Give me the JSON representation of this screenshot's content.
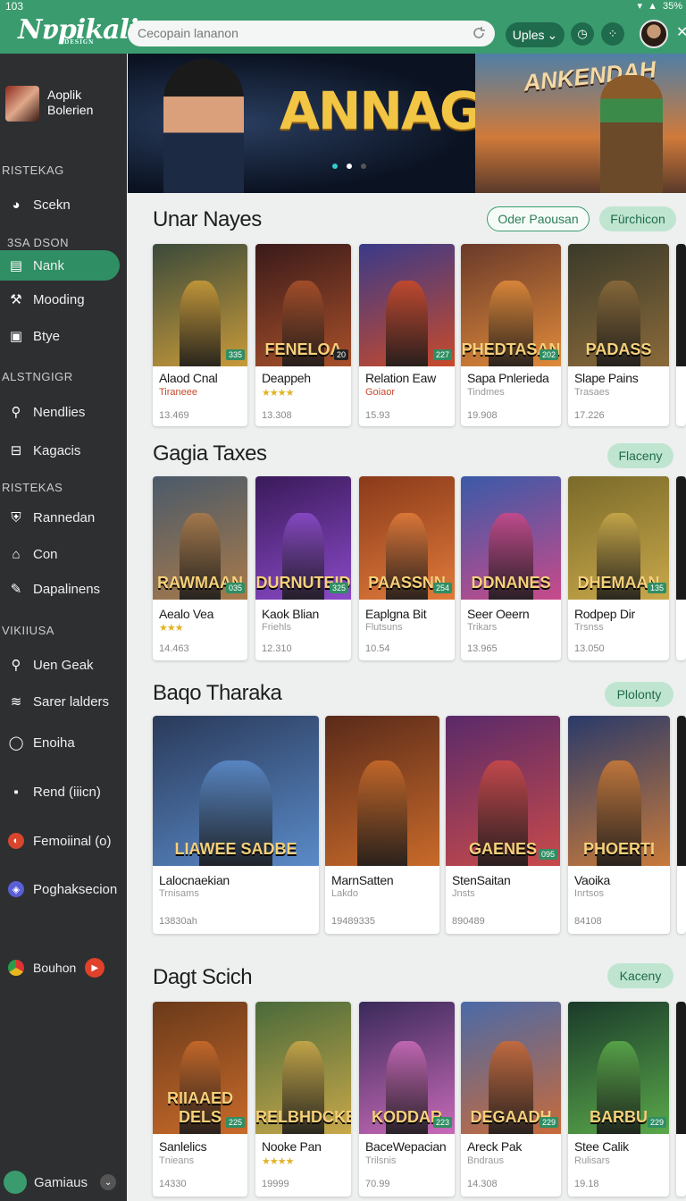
{
  "status": {
    "time": "103",
    "battery": "35%"
  },
  "header": {
    "logo": "Nɐpikali",
    "logo_sub": "DESIGN",
    "search_placeholder": "Cecopain lananon",
    "update_label": "Uples",
    "icons": [
      "clock-icon",
      "grid-icon"
    ]
  },
  "sidebar": {
    "profile": {
      "line1": "Aoplik",
      "line2": "Bolerien"
    },
    "sections": [
      {
        "label": "RISTEKAG",
        "items": [
          {
            "label": "Scekn",
            "icon": "paint-icon"
          }
        ]
      },
      {
        "label": "3SA DSON",
        "items": [
          {
            "label": "Nank",
            "icon": "list-icon",
            "active": true
          },
          {
            "label": "Mooding",
            "icon": "tools-icon"
          },
          {
            "label": "Btye",
            "icon": "square-icon"
          }
        ]
      },
      {
        "label": "ALSTNGIGR",
        "items": [
          {
            "label": "Nendlies",
            "icon": "pin-icon"
          },
          {
            "label": "Kagacis",
            "icon": "window-icon"
          }
        ]
      },
      {
        "label": "RISTEKAS",
        "items": [
          {
            "label": "Rannedan",
            "icon": "shield-icon"
          },
          {
            "label": "Con",
            "icon": "home-icon"
          },
          {
            "label": "Dapalinens",
            "icon": "pen-icon"
          }
        ]
      },
      {
        "label": "VIKIIUSA",
        "items": [
          {
            "label": "Uen Geak",
            "icon": "pin-icon"
          },
          {
            "label": "Sarer lalders",
            "icon": "layers-icon"
          },
          {
            "label": "Enoiha",
            "icon": "chat-icon"
          },
          {
            "label": "Rend (iiicn)",
            "icon": "video-icon"
          },
          {
            "label": "Femoiinal (o)",
            "icon": "circle-icon"
          },
          {
            "label": "Poghaksecion",
            "icon": "compass-icon"
          },
          {
            "label": "Bouhon",
            "icon": "play-icon"
          }
        ]
      }
    ],
    "footer_user": "Gamiaus"
  },
  "hero": {
    "banner1_title": "ANNAGA",
    "banner2_title": "ANKENDAH"
  },
  "sections": [
    {
      "title": "Unar Nayes",
      "buttons": [
        "Oder Paousan",
        "Fürchicon"
      ],
      "cards": [
        {
          "name": "Alaod Cnal",
          "sub": "Tiraneee",
          "sub_style": "rd",
          "count": "13.469",
          "badge": "335",
          "word": ""
        },
        {
          "name": "Deappeh",
          "sub": "★★★★",
          "sub_style": "st",
          "count": "13.308",
          "badge": "20",
          "word": "FENELOA"
        },
        {
          "name": "Relation Eaw",
          "sub": "Goiaor",
          "sub_style": "rd",
          "count": "15.93",
          "badge": "227",
          "word": ""
        },
        {
          "name": "Sapa Pnlerieda",
          "sub": "Tindmes",
          "sub_style": "",
          "count": "19.908",
          "badge": "202",
          "word": "PHEDTASAN"
        },
        {
          "name": "Slape Pains",
          "sub": "Trasaes",
          "sub_style": "",
          "count": "17.226",
          "badge": "",
          "word": "PADASS"
        }
      ]
    },
    {
      "title": "Gagia Taxes",
      "buttons": [
        "Flaceny"
      ],
      "cards": [
        {
          "name": "Aealo Vea",
          "sub": "★★★",
          "sub_style": "st",
          "count": "14.463",
          "badge": "035",
          "word": "RAWMAAN"
        },
        {
          "name": "Kaok Blian",
          "sub": "Friehls",
          "sub_style": "",
          "count": "12.310",
          "badge": "325",
          "word": "DURNUTEID"
        },
        {
          "name": "Eaplgna Bit",
          "sub": "Flutsuns",
          "sub_style": "",
          "count": "10.54",
          "badge": "254",
          "word": "PAASSNN"
        },
        {
          "name": "Seer Oeern",
          "sub": "Trikars",
          "sub_style": "",
          "count": "13.965",
          "badge": "",
          "word": "DDNANES"
        },
        {
          "name": "Rodpep Dir",
          "sub": "Trsnss",
          "sub_style": "",
          "count": "13.050",
          "badge": "135",
          "word": "DHEMAAN"
        }
      ]
    },
    {
      "title": "Baqo Tharaka",
      "buttons": [
        "Plolonty"
      ],
      "cards": [
        {
          "name": "Lalocnaekian",
          "sub": "Trnisams",
          "sub_style": "",
          "count": "13830ah",
          "badge": "",
          "word": "LIAWEE SADBE"
        },
        {
          "name": "MarnSatten",
          "sub": "Lakdo",
          "sub_style": "",
          "count": "19489335",
          "badge": "",
          "word": ""
        },
        {
          "name": "StenSaitan",
          "sub": "Jnsts",
          "sub_style": "",
          "count": "890489",
          "badge": "095",
          "word": "GAENES"
        },
        {
          "name": "Vaoika",
          "sub": "Inrtsos",
          "sub_style": "",
          "count": "84108",
          "badge": "",
          "word": "PHOERTI"
        }
      ]
    },
    {
      "title": "Dagt Scich",
      "buttons": [
        "Kaceny"
      ],
      "cards": [
        {
          "name": "Sanlelics",
          "sub": "Tnieans",
          "sub_style": "",
          "count": "14330",
          "badge": "225",
          "word": "RIIAAED DELS"
        },
        {
          "name": "Nooke Pan",
          "sub": "★★★★",
          "sub_style": "st",
          "count": "19999",
          "badge": "",
          "word": "RELBHDCKER"
        },
        {
          "name": "BaceWepacian",
          "sub": "Trilsnis",
          "sub_style": "",
          "count": "70.99",
          "badge": "223",
          "word": "KODDAR"
        },
        {
          "name": "Areck Pak",
          "sub": "Bndraus",
          "sub_style": "",
          "count": "14.308",
          "badge": "229",
          "word": "DEGAADH"
        },
        {
          "name": "Stee Calik",
          "sub": "Rulisars",
          "sub_style": "",
          "count": "19.18",
          "badge": "229",
          "word": "BARBU"
        }
      ]
    }
  ]
}
